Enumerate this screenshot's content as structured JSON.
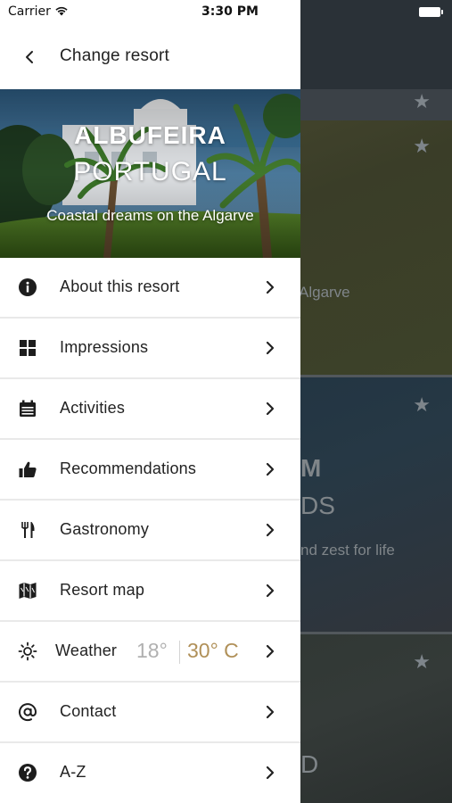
{
  "status_bar": {
    "carrier": "Carrier",
    "time": "3:30 PM"
  },
  "nav": {
    "title": "Change resort"
  },
  "hero": {
    "title": "ALBUFEIRA",
    "subtitle": "PORTUGAL",
    "tagline": "Coastal dreams on the Algarve"
  },
  "menu": {
    "items": [
      {
        "label": "About this resort",
        "icon": "info-icon"
      },
      {
        "label": "Impressions",
        "icon": "grid-icon"
      },
      {
        "label": "Activities",
        "icon": "calendar-icon"
      },
      {
        "label": "Recommendations",
        "icon": "thumbs-up-icon"
      },
      {
        "label": "Gastronomy",
        "icon": "fork-knife-icon"
      },
      {
        "label": "Resort map",
        "icon": "map-icon"
      },
      {
        "label": "Contact",
        "icon": "at-icon"
      },
      {
        "label": "A-Z",
        "icon": "question-icon"
      }
    ]
  },
  "weather": {
    "label": "Weather",
    "low": "18°",
    "high": "30° C",
    "icon": "sun-icon"
  },
  "background": {
    "card1_text": "Algarve",
    "card2_title": "M",
    "card2_sub": "DS",
    "card2_text": "nd zest for life",
    "card3_sub": "D"
  },
  "colors": {
    "accent_gold": "#b09058",
    "text": "#222222",
    "separator": "#e9e9e9"
  }
}
